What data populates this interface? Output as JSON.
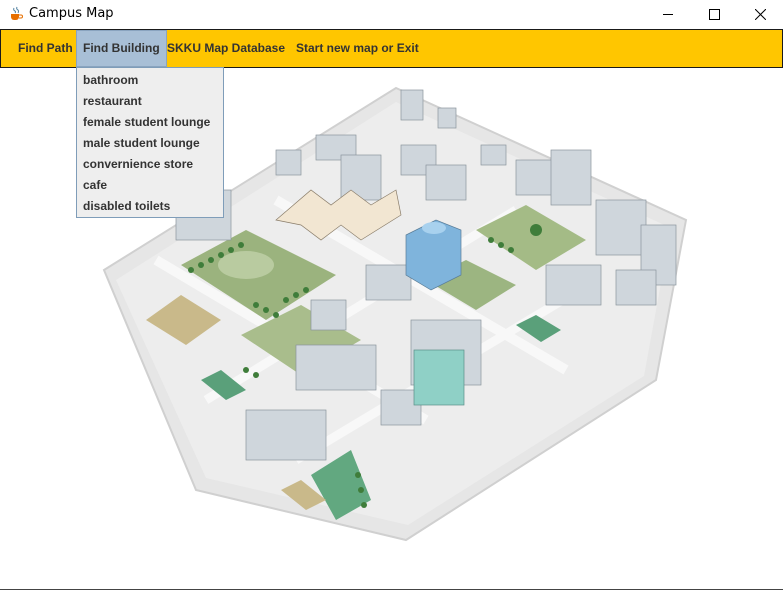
{
  "window": {
    "title": "Campus Map",
    "icon": "java-cup-icon",
    "controls": [
      "minimize-icon",
      "maximize-icon",
      "close-icon"
    ]
  },
  "menubar": {
    "background": "#ffc600",
    "active_background": "#a8bfd6",
    "items": [
      {
        "label": "Find Path"
      },
      {
        "label": "Find Building"
      },
      {
        "label": "SKKU Map Database"
      },
      {
        "label": "Start new map or Exit"
      }
    ]
  },
  "dropdown": {
    "parent": "Find Building",
    "items": [
      "bathroom",
      "restaurant",
      "female student lounge",
      "male student lounge",
      "convernience store",
      "cafe",
      "disabled toilets"
    ]
  },
  "map": {
    "description_icon": "campus-isometric-map-icon"
  }
}
